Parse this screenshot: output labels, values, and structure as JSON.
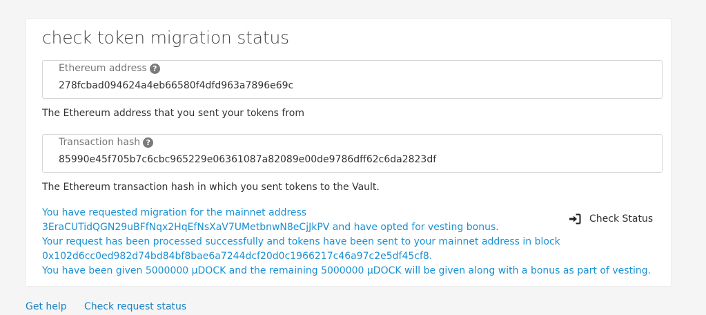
{
  "card": {
    "title": "check token migration status"
  },
  "eth_address_field": {
    "label": "Ethereum address",
    "value": "278fcbad094624a4eb66580f4dfd963a7896e69c",
    "helper": "The Ethereum address that you sent your tokens from",
    "help_icon": "question-circle-icon"
  },
  "tx_hash_field": {
    "label": "Transaction hash",
    "value": "85990e45f705b7c6cbc965229e06361087a82089e00de9786dff62c6da2823df",
    "helper": "The Ethereum transaction hash in which you sent tokens to the Vault.",
    "help_icon": "question-circle-icon"
  },
  "status_message": {
    "lines": [
      "You have requested migration for the mainnet address",
      "3EraCUTidQGN29uBFfNqx2HqEfNsXaV7UMetbnwN8eCjJkPV and have opted for vesting bonus.",
      "Your request has been processed successfully and tokens have been sent to your mainnet address in block",
      "0x102d6cc0ed982d74bd84bf8bae6a7244dcf20d0c1966217c46a97c2e5df45cf8.",
      "You have been given 5000000 µDOCK and the remaining 5000000 µDOCK will be given along with a bonus as part of vesting."
    ],
    "color": "#1a90d2"
  },
  "check_status_button": {
    "label": "Check Status",
    "icon": "sign-in-icon"
  },
  "footer": {
    "get_help": "Get help",
    "check_request_status": "Check request status",
    "link_color": "#1a7fc1"
  }
}
